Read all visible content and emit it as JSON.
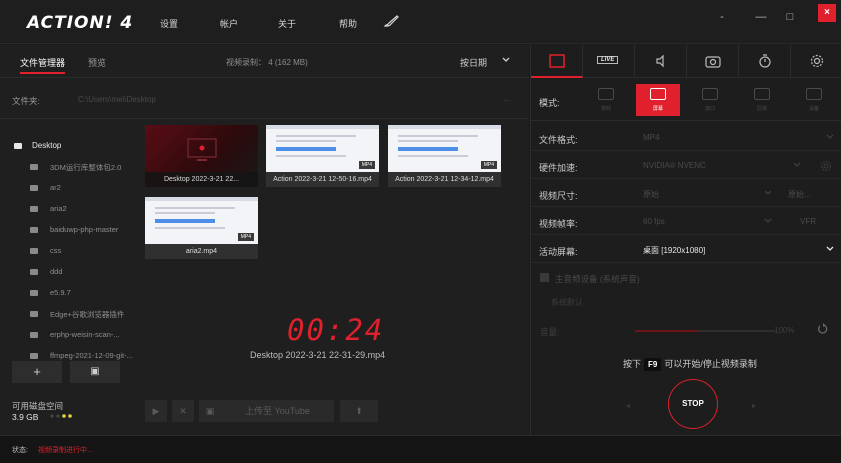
{
  "app": {
    "logo": "ACTION! 4",
    "menu": [
      "设置",
      "帐户",
      "关于",
      "帮助"
    ],
    "window_controls": [
      "-",
      "—",
      "□",
      "×"
    ]
  },
  "left": {
    "tabs": [
      {
        "label": "文件管理器",
        "active": true
      },
      {
        "label": "预览",
        "active": false
      }
    ],
    "recording_info": "视频录制： 4 (162 MB)",
    "sort_label": "按日期",
    "folder_label": "文件夹:",
    "folder_path": "C:\\Users\\mei\\Desktop",
    "folder_more": "...",
    "tree": [
      "Desktop",
      "3DM运行库整体包2.0",
      "ar2",
      "aria2",
      "baiduwp-php-master",
      "css",
      "ddd",
      "e5.9.7",
      "Edge+谷歌浏览器插件",
      "erphp-weisin-scan-...",
      "ffmpeg-2021-12-09-git-..."
    ],
    "tree_buttons": [
      "+",
      "▣"
    ],
    "disk_label": "可用磁盘空间",
    "disk_size": "3.9 GB",
    "thumbs": [
      {
        "caption": "Desktop 2022-3-21 22...",
        "style": "red"
      },
      {
        "caption": "Action 2022-3-21 12-50-16.mp4",
        "badge": "MP4",
        "style": "doc"
      },
      {
        "caption": "Action 2022-3-21 12-34-12.mp4",
        "badge": "MP4",
        "style": "doc"
      },
      {
        "caption": "aria2.mp4",
        "badge": "MP4",
        "style": "doc"
      }
    ],
    "timer": "00:24",
    "timer_file": "Desktop 2022-3-21 22-31-29.mp4",
    "controls": [
      "▶",
      "✕",
      "▣",
      "上传至 YouTube",
      "⬆"
    ]
  },
  "right": {
    "tabs": [
      "record",
      "LIVE",
      "audio",
      "camera",
      "timer",
      "settings"
    ],
    "live_label": "LIVE",
    "mode_label": "模式:",
    "modes": [
      {
        "label": "游戏",
        "active": false
      },
      {
        "label": "屏幕",
        "active": true
      },
      {
        "label": "窗口",
        "active": false
      },
      {
        "label": "区域",
        "active": false
      },
      {
        "label": "设备",
        "active": false
      }
    ],
    "settings": [
      {
        "label": "文件格式:",
        "value": "MP4",
        "bright": false
      },
      {
        "label": "硬件加速:",
        "value": "NVIDIA® NVENC",
        "bright": false
      },
      {
        "label": "视频尺寸:",
        "value": "原始",
        "value2": "原始...",
        "bright": false
      },
      {
        "label": "视频帧率:",
        "value": "60 fps",
        "value2": "VFR",
        "bright": false
      },
      {
        "label": "活动屏幕:",
        "value": "桌面 [1920x1080]",
        "bright": true
      }
    ],
    "audio_title": "主音频设备 (系统声音)",
    "audio_device": "系统默认",
    "volume_label": "音量:",
    "volume_pct": "100%",
    "volume_fraction": 0.45,
    "hint_pre": "按下",
    "hint_key": "F9",
    "hint_post": "可以开始/停止视频录制",
    "stop_label": "STOP",
    "stop_left": "◂",
    "stop_right": "▸"
  },
  "status": {
    "label": "状态:",
    "value": "视频录制进行中..."
  },
  "colors": {
    "accent": "#e0202c",
    "background": "#1b1b1b"
  }
}
